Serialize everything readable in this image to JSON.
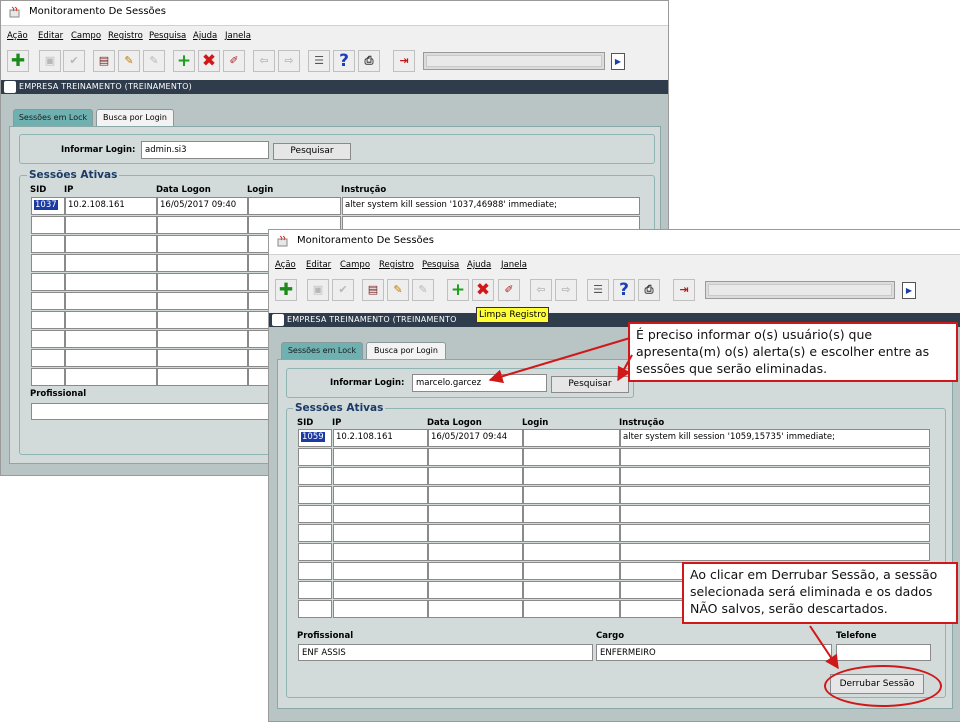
{
  "window": {
    "title": "Monitoramento De Sessões",
    "menu": [
      "Ação",
      "Editar",
      "Campo",
      "Registro",
      "Pesquisa",
      "Ajuda",
      "Janela"
    ],
    "form_title": "EMPRESA TREINAMENTO (TREINAMENTO)",
    "form_title_truncated": "EMPRESA TREINAMENTO (TREINAMENTO",
    "tabs": [
      "Sessões em Lock",
      "Busca por Login"
    ],
    "login_label": "Informar Login:",
    "search_button": "Pesquisar",
    "section_title": "Sessões Ativas",
    "columns": [
      "SID",
      "IP",
      "Data Logon",
      "Login",
      "Instrução"
    ],
    "profissional_label": "Profissional",
    "cargo_label": "Cargo",
    "telefone_label": "Telefone",
    "derrubar_button": "Derrubar Sessão"
  },
  "back_window": {
    "login_value": "admin.si3",
    "row": {
      "sid": "1037",
      "ip": "10.2.108.161",
      "data_logon": "16/05/2017 09:40",
      "login": "",
      "instrucao": "alter system kill session '1037,46988' immediate;"
    }
  },
  "front_window": {
    "login_value": "marcelo.garcez",
    "row": {
      "sid": "1059",
      "ip": "10.2.108.161",
      "data_logon": "16/05/2017 09:44",
      "login": "",
      "instrucao": "alter system kill session '1059,15735' immediate;"
    },
    "profissional": "ENF ASSIS",
    "cargo": "ENFERMEIRO",
    "telefone": "",
    "tooltip": "Limpa Registro"
  },
  "callouts": {
    "login_hint": "É preciso informar o(s) usuário(s) que apresenta(m) o(s) alerta(s) e escolher entre as sessões que serão eliminadas.",
    "derrubar_hint": "Ao clicar em Derrubar Sessão, a sessão selecionada será eliminada e os dados NÃO salvos, serão descartados."
  },
  "toolbar_icons": [
    "save-icon",
    "save-disabled-icon",
    "checkmark-icon",
    "print-form-icon",
    "wand-icon",
    "wand-disabled-icon",
    "insert-record-icon",
    "delete-record-icon",
    "clear-record-icon",
    "previous-icon",
    "next-icon",
    "list-values-icon",
    "help-icon",
    "printer-icon",
    "exit-icon"
  ],
  "colors": {
    "form_bar": "#2f3c4c",
    "tab_inactive": "#6fb0b0",
    "selection": "#1c3aa3",
    "callout_border": "#d01818",
    "tooltip": "#ffff33"
  }
}
